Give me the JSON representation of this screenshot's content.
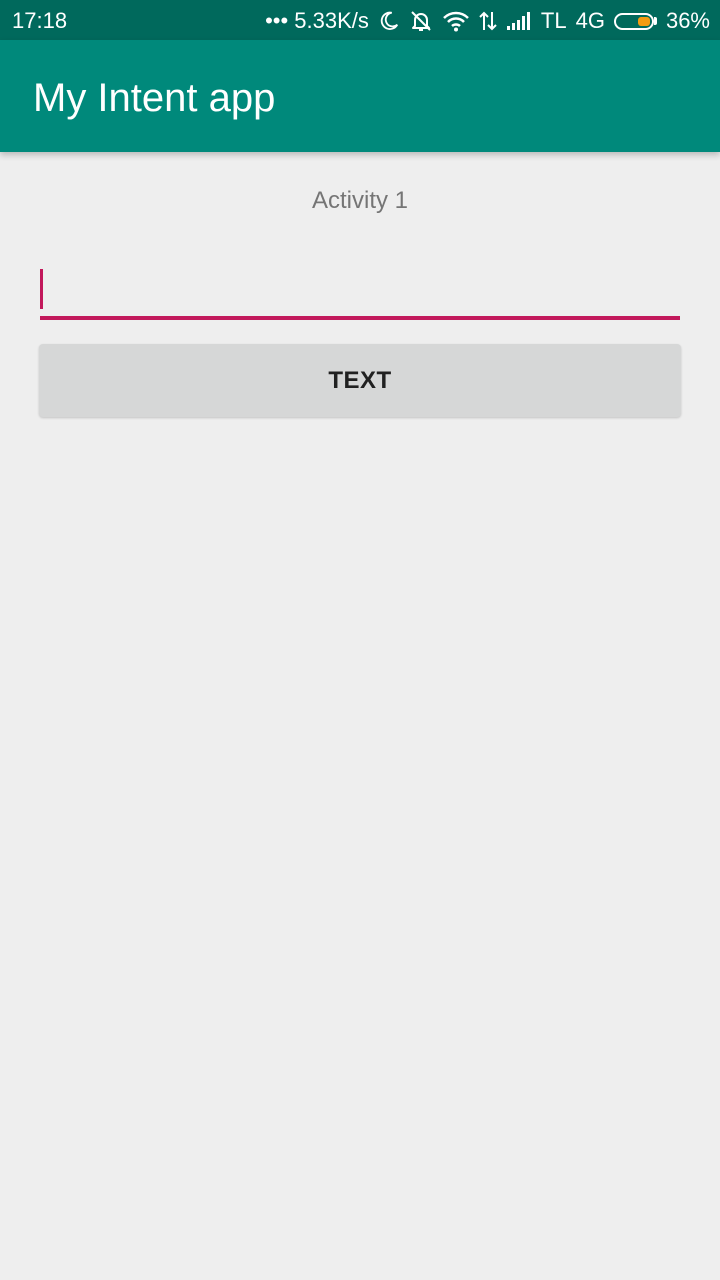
{
  "status_bar": {
    "time": "17:18",
    "network_speed": "••• 5.33K/s",
    "carrier": "TL",
    "network_type": "4G",
    "battery_level": 36,
    "battery_text": "36%",
    "icons": [
      "moon-icon",
      "bell-off-icon",
      "wifi-icon",
      "data-transfer-icon",
      "signal-icon",
      "battery-icon"
    ],
    "battery_color": "#f39c12"
  },
  "app_bar": {
    "title": "My Intent app"
  },
  "main": {
    "activity_label": "Activity 1",
    "input_value": "",
    "button_label": "TEXT"
  },
  "colors": {
    "status_bar": "#00695c",
    "app_bar": "#00897b",
    "accent": "#c2185b",
    "background": "#eeeeee",
    "button": "#d6d7d7"
  }
}
